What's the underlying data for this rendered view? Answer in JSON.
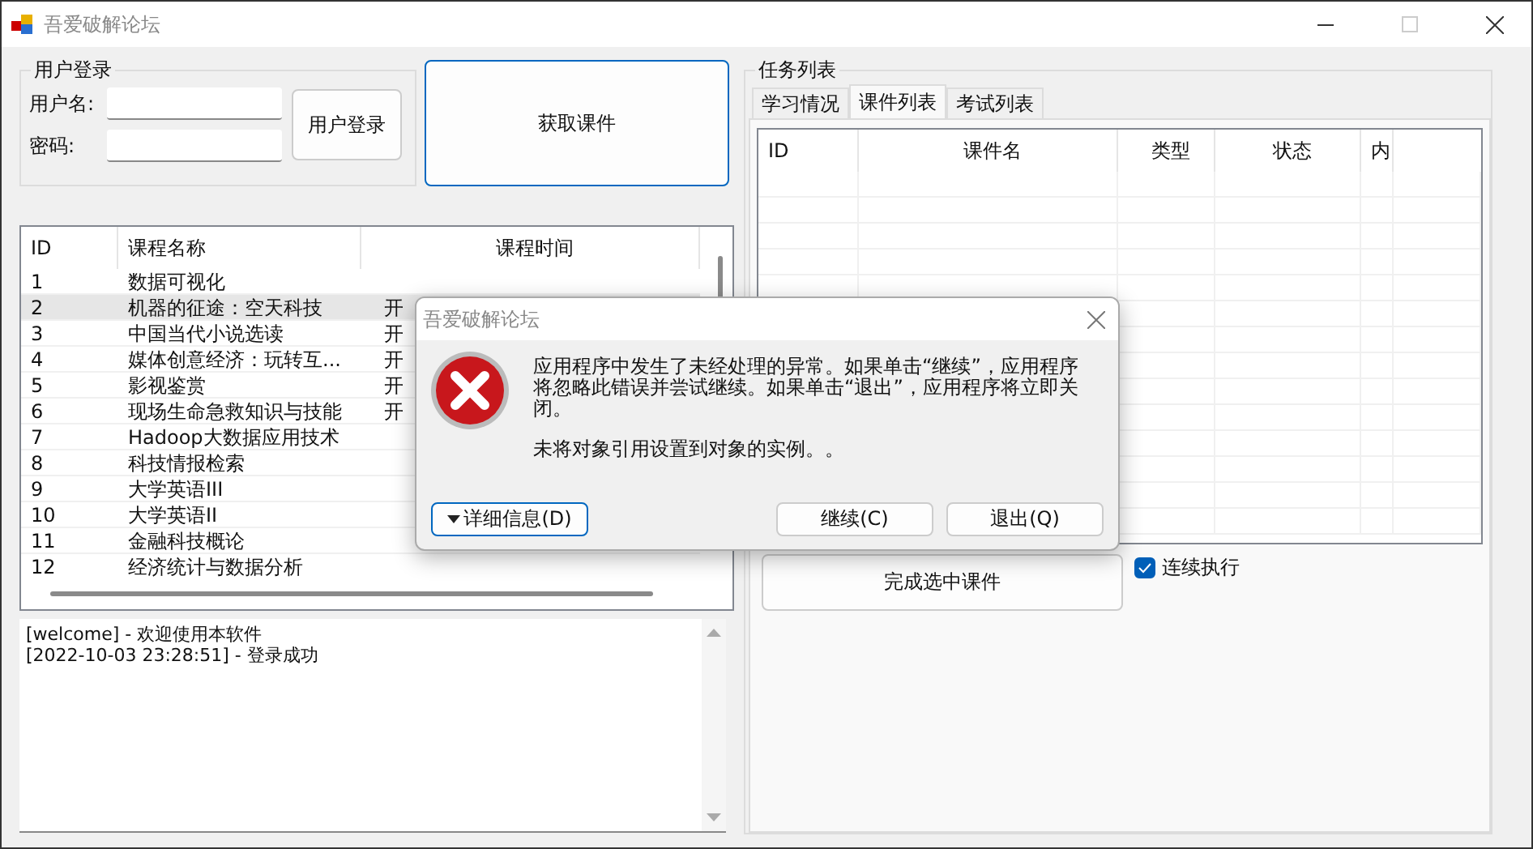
{
  "window": {
    "title": "吾爱破解论坛"
  },
  "login": {
    "legend": "用户登录",
    "fields": [
      {
        "label": "用户名:"
      },
      {
        "label": "密码:"
      }
    ],
    "button": "用户登录"
  },
  "fetch_button": "获取课件",
  "courses": {
    "columns": [
      "ID",
      "课程名称",
      "课程时间"
    ],
    "rows": [
      {
        "id": "1",
        "name": "数据可视化",
        "selected": false
      },
      {
        "id": "2",
        "name": "机器的征途：空天科技",
        "time": "开",
        "selected": true
      },
      {
        "id": "3",
        "name": "中国当代小说选读",
        "time": "开",
        "selected": false
      },
      {
        "id": "4",
        "name": "媒体创意经济：玩转互...",
        "time": "开",
        "selected": false
      },
      {
        "id": "5",
        "name": "影视鉴赏",
        "time": "开",
        "selected": false
      },
      {
        "id": "6",
        "name": "现场生命急救知识与技能",
        "time": "开",
        "selected": false
      },
      {
        "id": "7",
        "name": "Hadoop大数据应用技术",
        "selected": false
      },
      {
        "id": "8",
        "name": "科技情报检索",
        "selected": false
      },
      {
        "id": "9",
        "name": "大学英语III",
        "selected": false
      },
      {
        "id": "10",
        "name": "大学英语II",
        "selected": false
      },
      {
        "id": "11",
        "name": "金融科技概论",
        "selected": false
      },
      {
        "id": "12",
        "name": "经济统计与数据分析",
        "selected": false
      }
    ]
  },
  "log": {
    "lines": [
      "[welcome] - 欢迎使用本软件",
      "[2022-10-03 23:28:51] - 登录成功"
    ]
  },
  "tasks": {
    "legend": "任务列表",
    "tabs": [
      {
        "label": "学习情况",
        "selected": false
      },
      {
        "label": "课件列表",
        "selected": true
      },
      {
        "label": "考试列表",
        "selected": false
      }
    ],
    "columns": [
      "ID",
      "课件名",
      "类型",
      "状态",
      "内"
    ],
    "complete_button": "完成选中课件",
    "continuous": {
      "label": "连续执行",
      "checked": true
    }
  },
  "dialog": {
    "title": "吾爱破解论坛",
    "message": "应用程序中发生了未经处理的异常。如果单击“继续”，应用程序将忽略此错误并尝试继续。如果单击“退出”，应用程序将立即关闭。",
    "detail": "未将对象引用设置到对象的实例。。",
    "buttons": [
      {
        "label": "详细信息(D)",
        "kind": "details"
      },
      {
        "label": "继续(C)",
        "kind": "action"
      },
      {
        "label": "退出(Q)",
        "kind": "action"
      }
    ]
  }
}
